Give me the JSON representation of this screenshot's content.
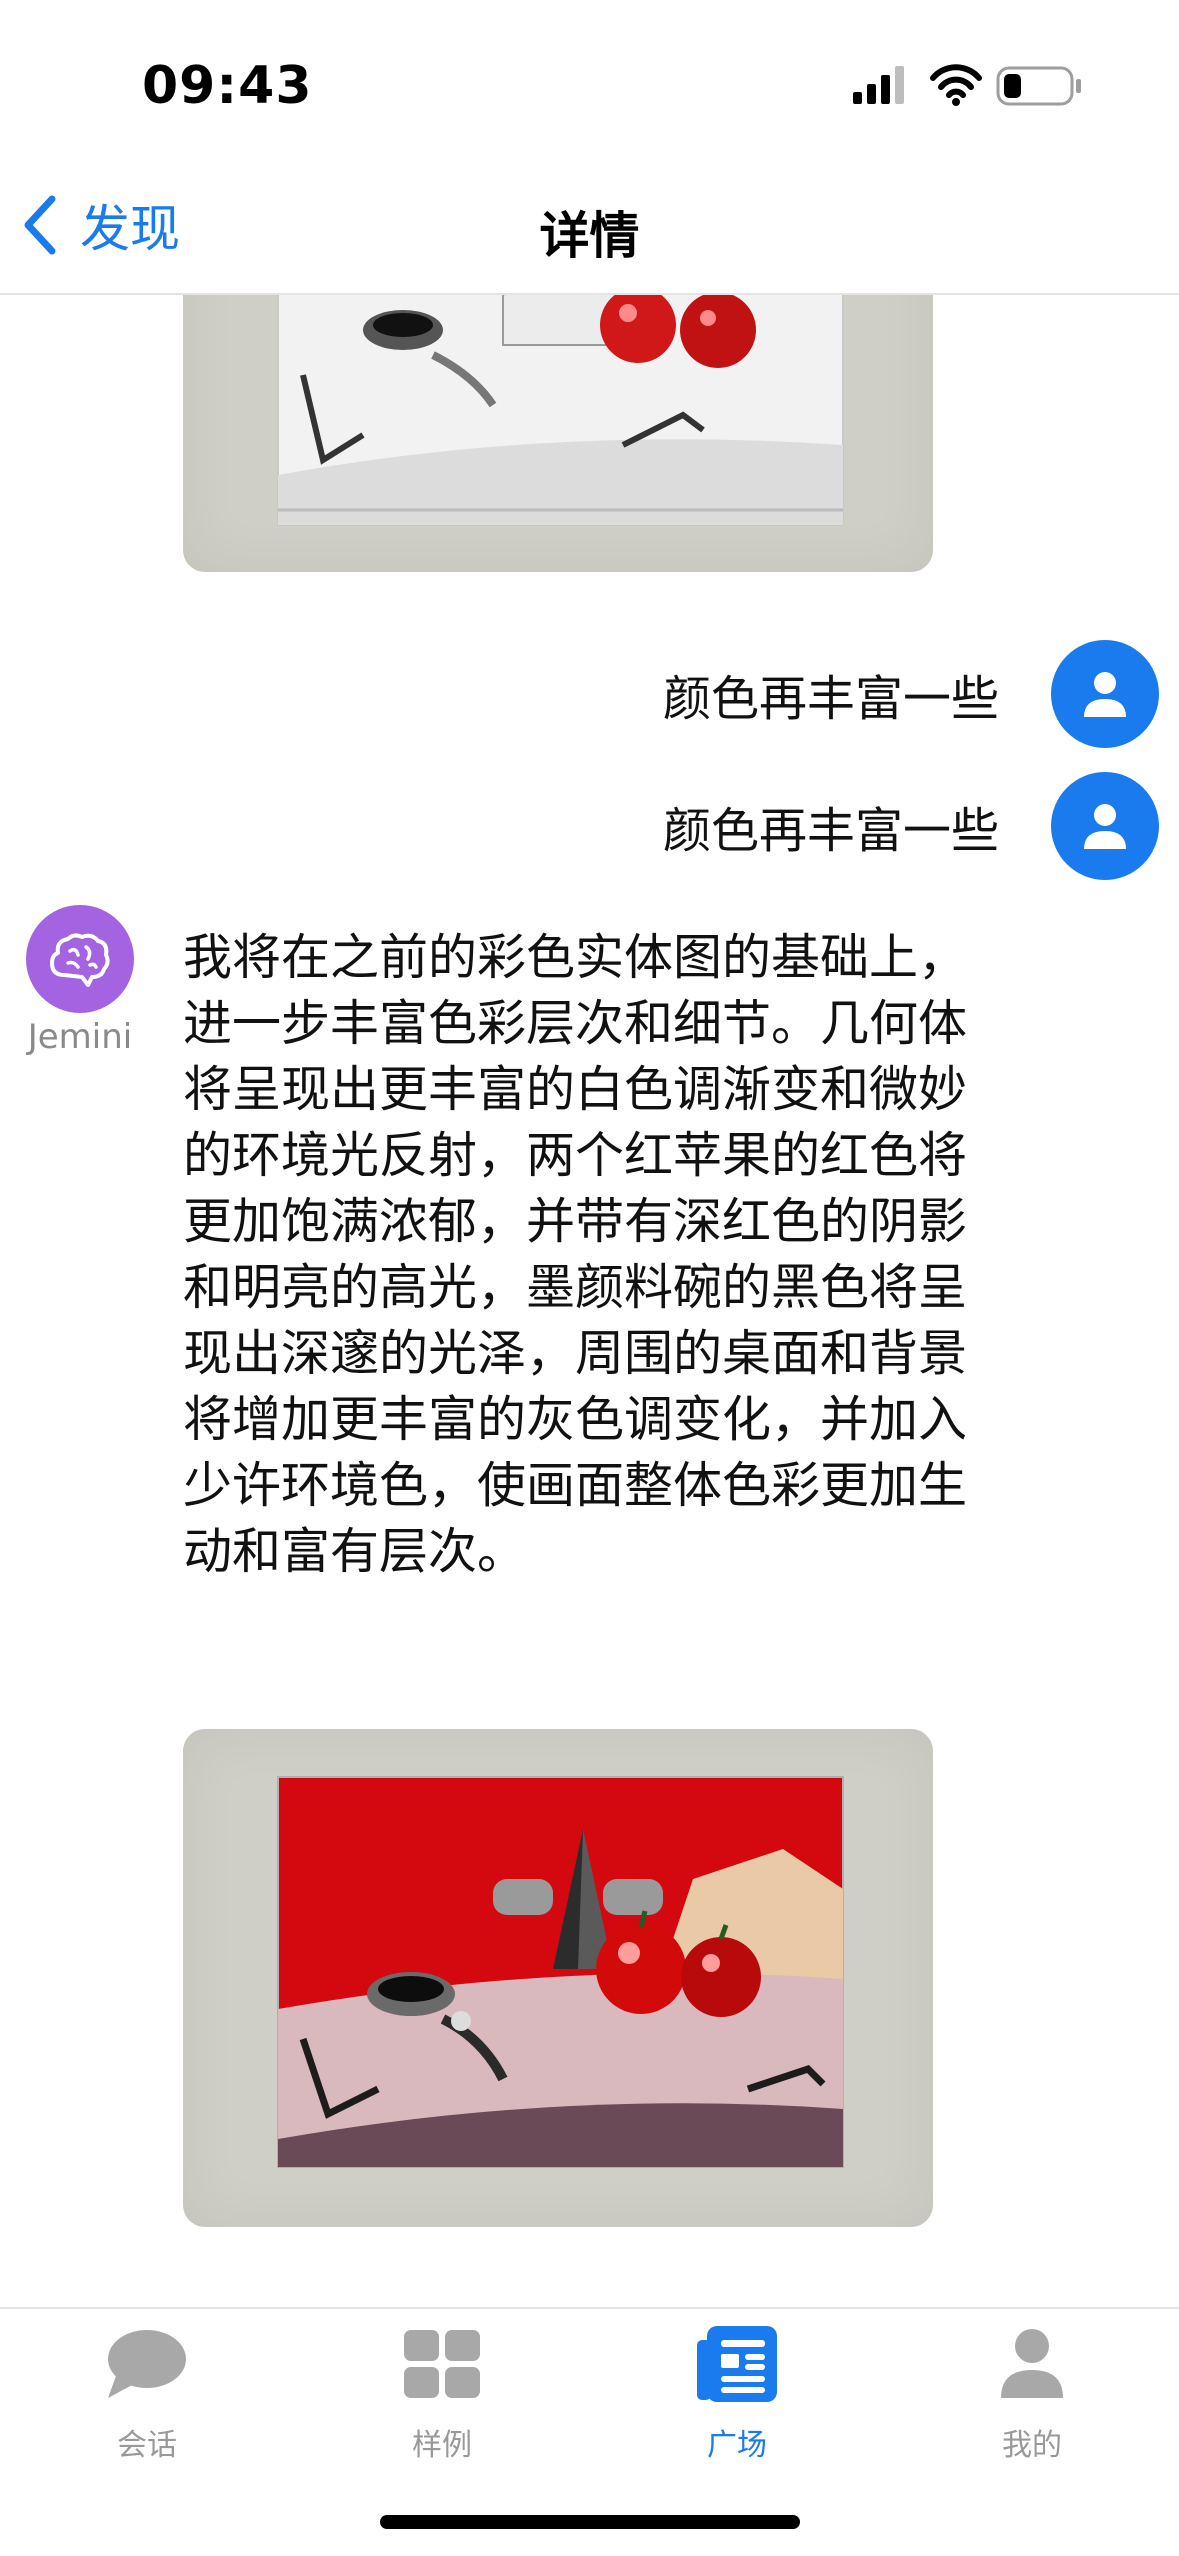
{
  "status_bar": {
    "time": "09:43"
  },
  "nav": {
    "back_label": "发现",
    "title": "详情"
  },
  "chat": {
    "user_messages": [
      "颜色再丰富一些",
      "颜色再丰富一些"
    ],
    "bot_name": "Jemini",
    "bot_message": "我将在之前的彩色实体图的基础上，进一步丰富色彩层次和细节。几何体将呈现出更丰富的白色调渐变和微妙的环境光反射，两个红苹果的红色将更加饱满浓郁，并带有深红色的阴影和明亮的高光，墨颜料碗的黑色将呈现出深邃的光泽，周围的桌面和背景将增加更丰富的灰色调变化，并加入少许环境色，使画面整体色彩更加生动和富有层次。"
  },
  "tabs": [
    {
      "label": "会话",
      "icon": "chat-bubble-icon"
    },
    {
      "label": "样例",
      "icon": "grid-icon"
    },
    {
      "label": "广场",
      "icon": "news-icon",
      "active": true
    },
    {
      "label": "我的",
      "icon": "person-icon"
    }
  ],
  "colors": {
    "accent": "#1a7bef",
    "bot_avatar": "#a463e0",
    "tab_inactive": "#999999"
  }
}
